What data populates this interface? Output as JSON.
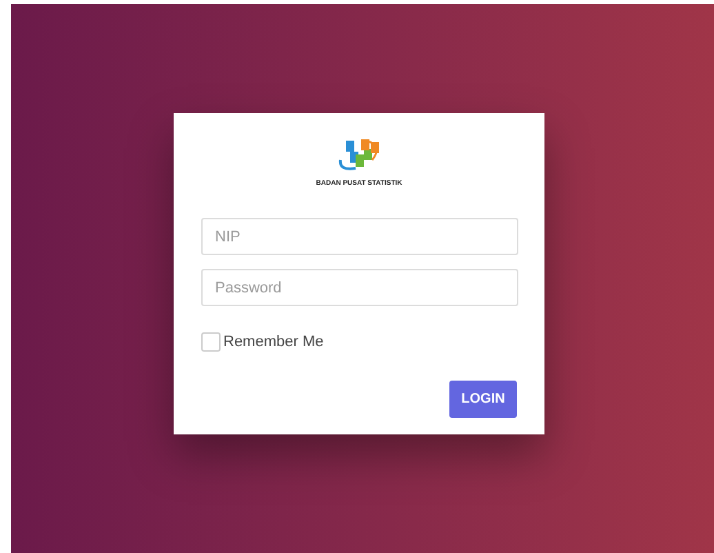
{
  "logo": {
    "caption": "BADAN PUSAT STATISTIK"
  },
  "fields": [
    {
      "placeholder": "NIP"
    },
    {
      "placeholder": "Password"
    }
  ],
  "remember": {
    "label": "Remember Me",
    "checked": false
  },
  "button": {
    "label": "LOGIN"
  }
}
